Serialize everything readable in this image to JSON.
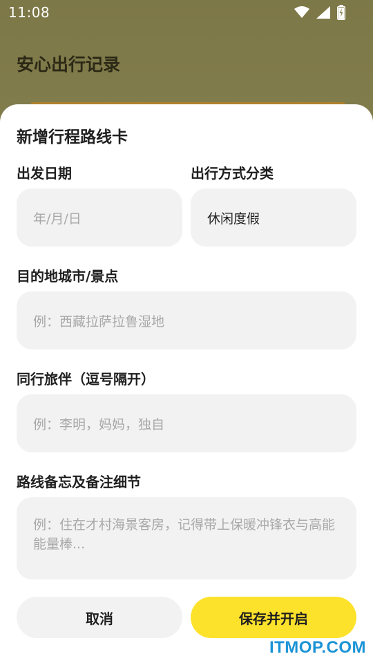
{
  "status_bar": {
    "time": "11:08",
    "icons": [
      "wifi-icon",
      "cellular-signal-icon",
      "battery-charging-icon"
    ]
  },
  "background_screen": {
    "title": "安心出行记录"
  },
  "sheet": {
    "title": "新增行程路线卡",
    "date": {
      "label": "出发日期",
      "placeholder": "年/月/日"
    },
    "travel_type": {
      "label": "出行方式分类",
      "value": "休闲度假"
    },
    "destination": {
      "label": "目的地城市/景点",
      "placeholder": "例：西藏拉萨拉鲁湿地"
    },
    "companions": {
      "label": "同行旅伴（逗号隔开）",
      "placeholder": "例：李明，妈妈，独自"
    },
    "notes": {
      "label": "路线备忘及备注细节",
      "placeholder": "例：住在才村海景客房，记得带上保暖冲锋衣与高能能量棒..."
    },
    "cancel_label": "取消",
    "save_label": "保存并开启"
  },
  "watermark": "ITMOP.COM",
  "colors": {
    "accent": "#fde22c",
    "field_bg": "#f2f2f2",
    "watermark": "#1a93d6"
  }
}
